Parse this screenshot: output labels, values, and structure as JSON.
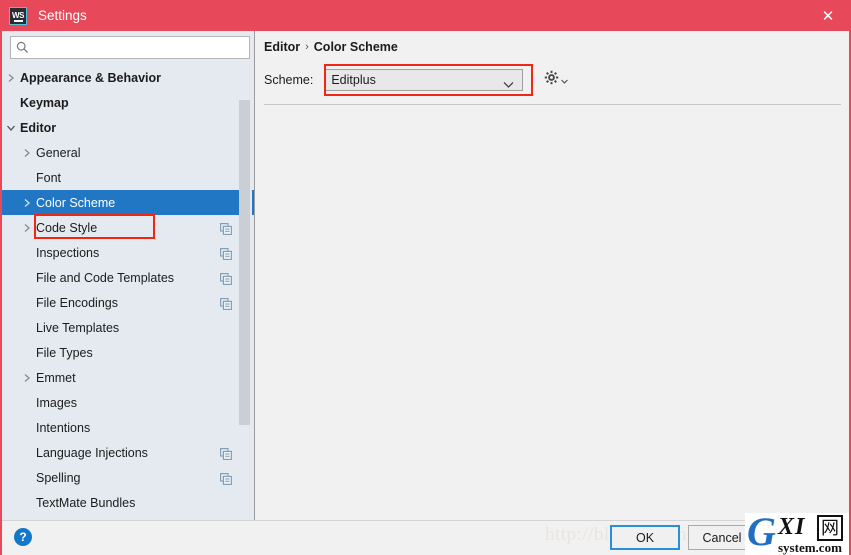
{
  "window": {
    "title": "Settings",
    "app_icon": "webstorm-logo-icon",
    "close_label": "✕",
    "titlebar_color": "#e8495a",
    "accent_color": "#2277c4",
    "highlight_color": "#f22613"
  },
  "search": {
    "value": "",
    "placeholder": "",
    "icon": "search-icon"
  },
  "sidebar": {
    "items": [
      {
        "label": "Appearance & Behavior",
        "level": 0,
        "arrow": "right",
        "bold": true,
        "selected": false,
        "copy_icon": false
      },
      {
        "label": "Keymap",
        "level": 0,
        "arrow": "none",
        "bold": true,
        "selected": false,
        "copy_icon": false
      },
      {
        "label": "Editor",
        "level": 0,
        "arrow": "down",
        "bold": true,
        "selected": false,
        "copy_icon": false
      },
      {
        "label": "General",
        "level": 1,
        "arrow": "right",
        "bold": false,
        "selected": false,
        "copy_icon": false
      },
      {
        "label": "Font",
        "level": 1,
        "arrow": "none",
        "bold": false,
        "selected": false,
        "copy_icon": false
      },
      {
        "label": "Color Scheme",
        "level": 1,
        "arrow": "right",
        "bold": false,
        "selected": true,
        "copy_icon": false
      },
      {
        "label": "Code Style",
        "level": 1,
        "arrow": "right",
        "bold": false,
        "selected": false,
        "copy_icon": true
      },
      {
        "label": "Inspections",
        "level": 1,
        "arrow": "none",
        "bold": false,
        "selected": false,
        "copy_icon": true
      },
      {
        "label": "File and Code Templates",
        "level": 1,
        "arrow": "none",
        "bold": false,
        "selected": false,
        "copy_icon": true
      },
      {
        "label": "File Encodings",
        "level": 1,
        "arrow": "none",
        "bold": false,
        "selected": false,
        "copy_icon": true
      },
      {
        "label": "Live Templates",
        "level": 1,
        "arrow": "none",
        "bold": false,
        "selected": false,
        "copy_icon": false
      },
      {
        "label": "File Types",
        "level": 1,
        "arrow": "none",
        "bold": false,
        "selected": false,
        "copy_icon": false
      },
      {
        "label": "Emmet",
        "level": 1,
        "arrow": "right",
        "bold": false,
        "selected": false,
        "copy_icon": false
      },
      {
        "label": "Images",
        "level": 1,
        "arrow": "none",
        "bold": false,
        "selected": false,
        "copy_icon": false
      },
      {
        "label": "Intentions",
        "level": 1,
        "arrow": "none",
        "bold": false,
        "selected": false,
        "copy_icon": false
      },
      {
        "label": "Language Injections",
        "level": 1,
        "arrow": "none",
        "bold": false,
        "selected": false,
        "copy_icon": true
      },
      {
        "label": "Spelling",
        "level": 1,
        "arrow": "none",
        "bold": false,
        "selected": false,
        "copy_icon": true
      },
      {
        "label": "TextMate Bundles",
        "level": 1,
        "arrow": "none",
        "bold": false,
        "selected": false,
        "copy_icon": false
      }
    ]
  },
  "content": {
    "breadcrumb": {
      "parent": "Editor",
      "separator": "›",
      "current": "Color Scheme"
    },
    "scheme": {
      "label": "Scheme:",
      "value": "Editplus",
      "options": [
        "Editplus"
      ],
      "gear_icon": "gear-icon"
    }
  },
  "footer": {
    "help_label": "?",
    "ok_label": "OK",
    "cancel_label": "Cancel",
    "watermark": "http://blog.csdn.net/"
  },
  "logo": {
    "g": "G",
    "xi": "XI",
    "wang": "网",
    "sub": "system.com"
  }
}
